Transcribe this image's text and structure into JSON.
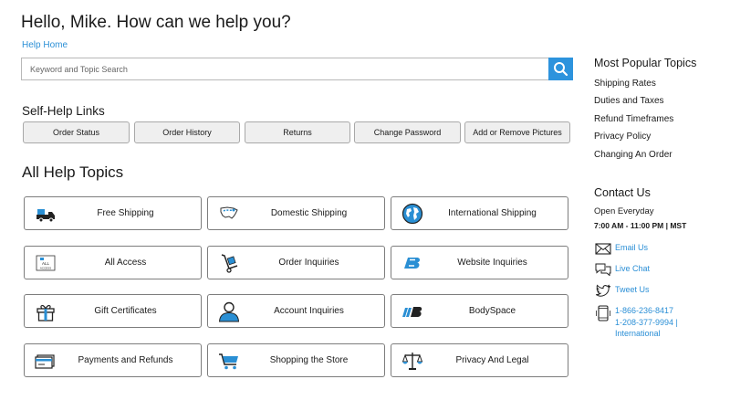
{
  "header": {
    "greeting": "Hello, Mike. How can we help you?",
    "help_home": "Help Home"
  },
  "search": {
    "placeholder": "Keyword and Topic Search",
    "button_icon": "search-icon"
  },
  "self_help": {
    "title": "Self-Help Links",
    "links": [
      "Order Status",
      "Order History",
      "Returns",
      "Change Password",
      "Add or Remove Pictures"
    ]
  },
  "topics": {
    "title": "All Help Topics",
    "items": [
      {
        "label": "Free Shipping",
        "icon": "delivery-truck-icon"
      },
      {
        "label": "Domestic Shipping",
        "icon": "us-map-icon"
      },
      {
        "label": "International Shipping",
        "icon": "globe-icon"
      },
      {
        "label": "All Access",
        "icon": "all-access-pass-icon"
      },
      {
        "label": "Order Inquiries",
        "icon": "hand-truck-icon"
      },
      {
        "label": "Website Inquiries",
        "icon": "bodybuilding-logo-icon"
      },
      {
        "label": "Gift Certificates",
        "icon": "gift-icon"
      },
      {
        "label": "Account Inquiries",
        "icon": "user-icon"
      },
      {
        "label": "BodySpace",
        "icon": "bodyspace-logo-icon"
      },
      {
        "label": "Payments and Refunds",
        "icon": "credit-card-icon"
      },
      {
        "label": "Shopping the Store",
        "icon": "shopping-cart-icon"
      },
      {
        "label": "Privacy And Legal",
        "icon": "scales-icon"
      }
    ]
  },
  "sidebar": {
    "popular_title": "Most Popular Topics",
    "popular": [
      "Shipping Rates",
      "Duties and Taxes",
      "Refund Timeframes",
      "Privacy Policy",
      "Changing An Order"
    ],
    "contact_title": "Contact Us",
    "hours_label": "Open Everyday",
    "hours": "7:00 AM - 11:00 PM | MST",
    "email": "Email Us",
    "chat": "Live Chat",
    "tweet": "Tweet Us",
    "phone_us": "1-866-236-8417",
    "phone_intl": "1-208-377-9994 |",
    "phone_intl_label": "International"
  },
  "colors": {
    "accent": "#2d93dd",
    "link": "#2b8fd6",
    "icon_blue": "#2a8fd4",
    "icon_dark": "#222222"
  }
}
